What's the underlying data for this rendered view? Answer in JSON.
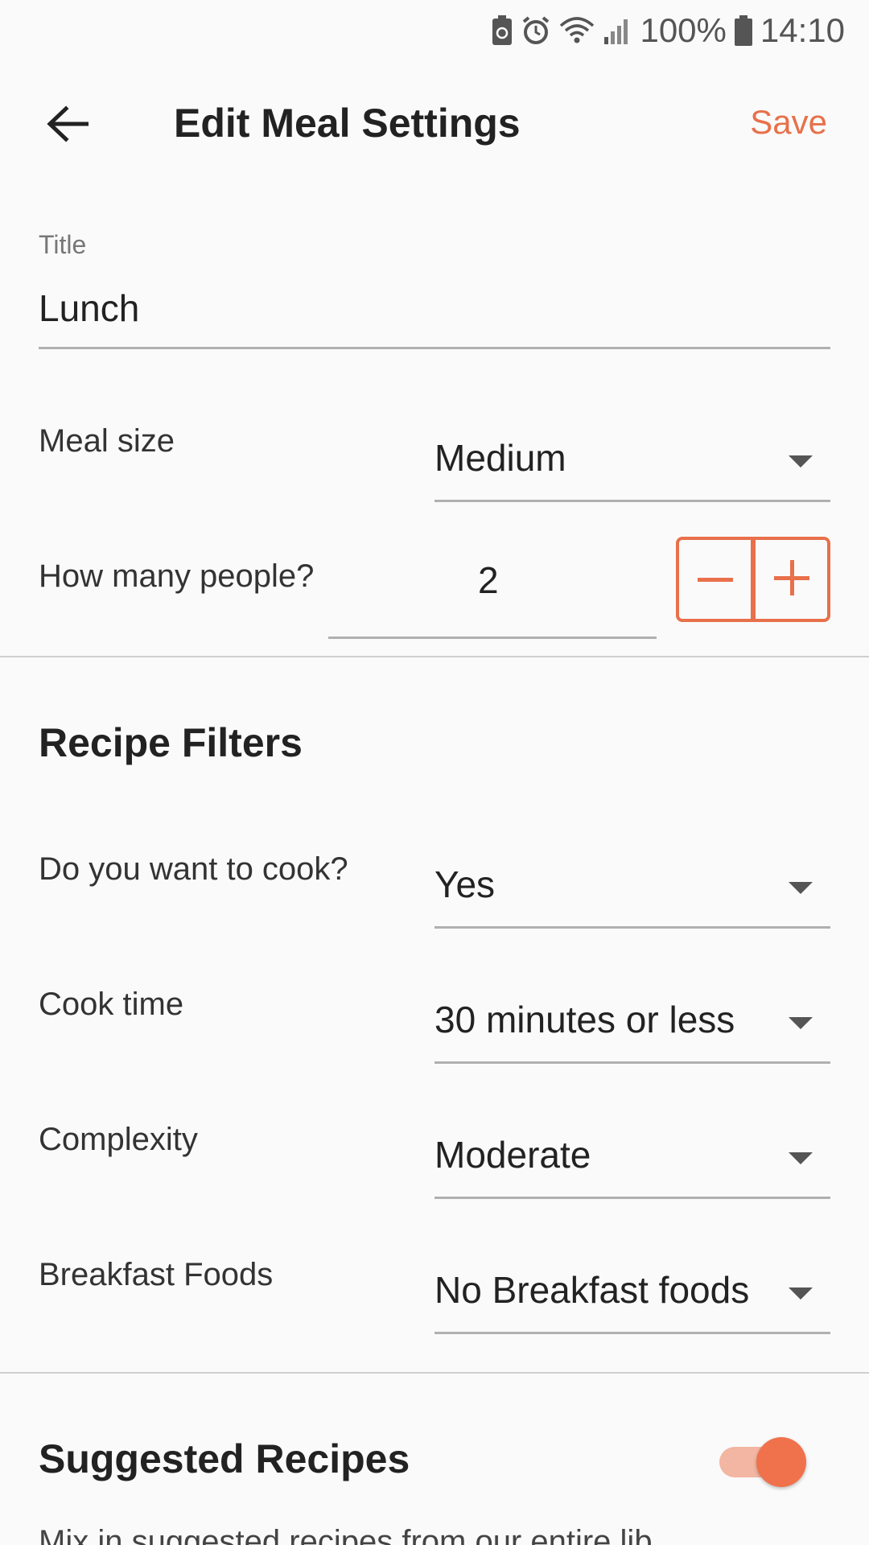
{
  "status_bar": {
    "battery_percent": "100%",
    "time": "14:10",
    "icons": [
      "battery-saver-icon",
      "alarm-icon",
      "wifi-icon",
      "signal-icon",
      "battery-icon"
    ]
  },
  "app_bar": {
    "title": "Edit Meal Settings",
    "save_label": "Save",
    "back_icon": "arrow-left-icon"
  },
  "meal": {
    "title_label": "Title",
    "title_value": "Lunch",
    "size_label": "Meal size",
    "size_value": "Medium",
    "people_label": "How many people?",
    "people_value": "2"
  },
  "recipe_filters": {
    "heading": "Recipe Filters",
    "cook_label": "Do you want to cook?",
    "cook_value": "Yes",
    "cook_time_label": "Cook time",
    "cook_time_value": "30 minutes or less",
    "complexity_label": "Complexity",
    "complexity_value": "Moderate",
    "breakfast_label": "Breakfast Foods",
    "breakfast_value": "No Breakfast foods"
  },
  "suggested": {
    "heading": "Suggested Recipes",
    "enabled": true,
    "description_partial": "Mix in suggested recipes from our entire lib"
  },
  "colors": {
    "accent": "#e8704a",
    "background": "#fafafa"
  }
}
